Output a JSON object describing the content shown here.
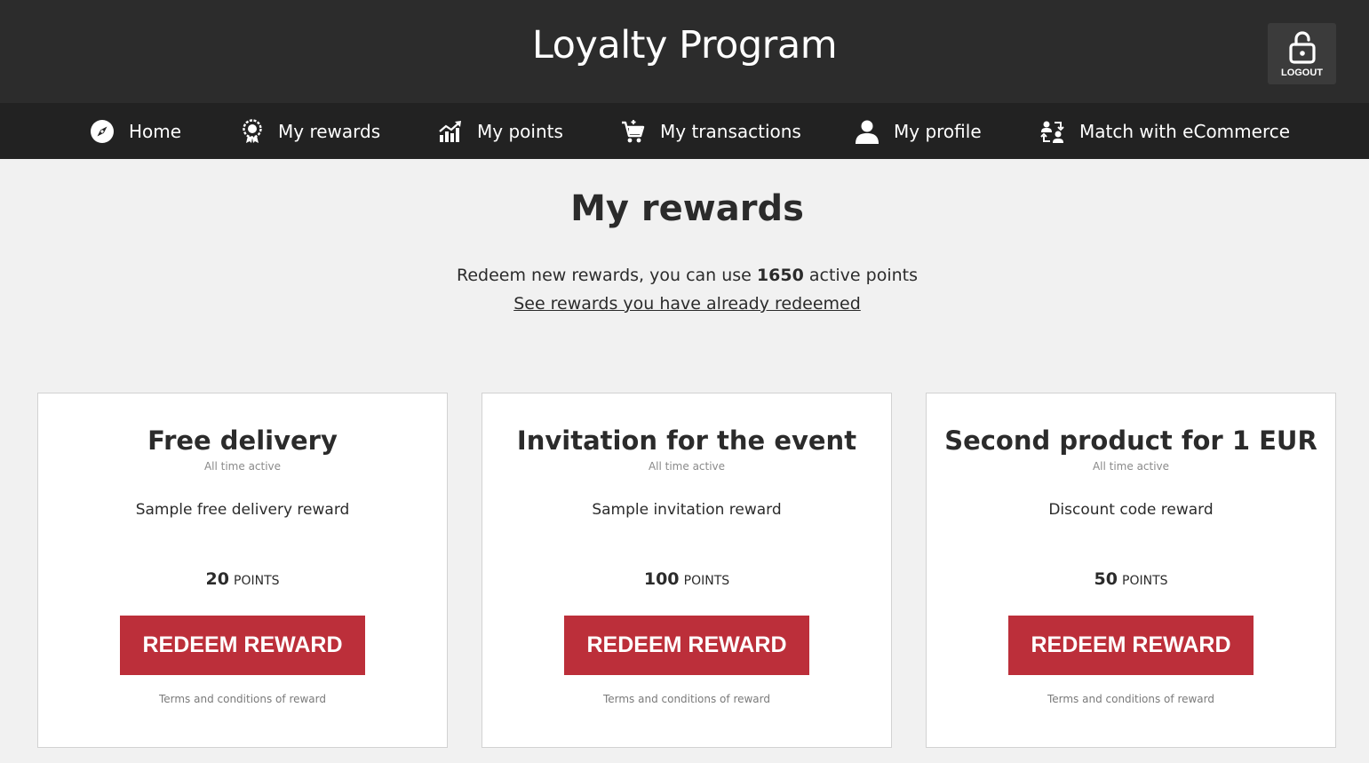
{
  "header": {
    "app_title": "Loyalty Program",
    "logout_label": "LOGOUT"
  },
  "nav": {
    "items": [
      {
        "label": "Home",
        "icon": "compass-icon"
      },
      {
        "label": "My rewards",
        "icon": "award-icon"
      },
      {
        "label": "My points",
        "icon": "chart-icon"
      },
      {
        "label": "My transactions",
        "icon": "cart-icon"
      },
      {
        "label": "My profile",
        "icon": "user-icon"
      },
      {
        "label": "Match with eCommerce",
        "icon": "match-icon"
      }
    ]
  },
  "main": {
    "title": "My rewards",
    "intro_prefix": "Redeem new rewards, you can use ",
    "active_points": "1650",
    "intro_suffix": " active points",
    "redeemed_link": "See rewards you have already redeemed"
  },
  "rewards": [
    {
      "title": "Free delivery",
      "availability": "All time active",
      "description": "Sample free delivery reward",
      "points": "20",
      "points_unit": "POINTS",
      "button_label": "REDEEM REWARD",
      "terms_link": "Terms and conditions of reward"
    },
    {
      "title": "Invitation for the event",
      "availability": "All time active",
      "description": "Sample invitation reward",
      "points": "100",
      "points_unit": "POINTS",
      "button_label": "REDEEM REWARD",
      "terms_link": "Terms and conditions of reward"
    },
    {
      "title": "Second product for 1 EUR",
      "availability": "All time active",
      "description": "Discount code reward",
      "points": "50",
      "points_unit": "POINTS",
      "button_label": "REDEEM REWARD",
      "terms_link": "Terms and conditions of reward"
    }
  ],
  "colors": {
    "header_bg": "#2c2c2c",
    "nav_bg": "#222222",
    "page_bg": "#f1f1f1",
    "accent_red": "#bc2f3a"
  }
}
